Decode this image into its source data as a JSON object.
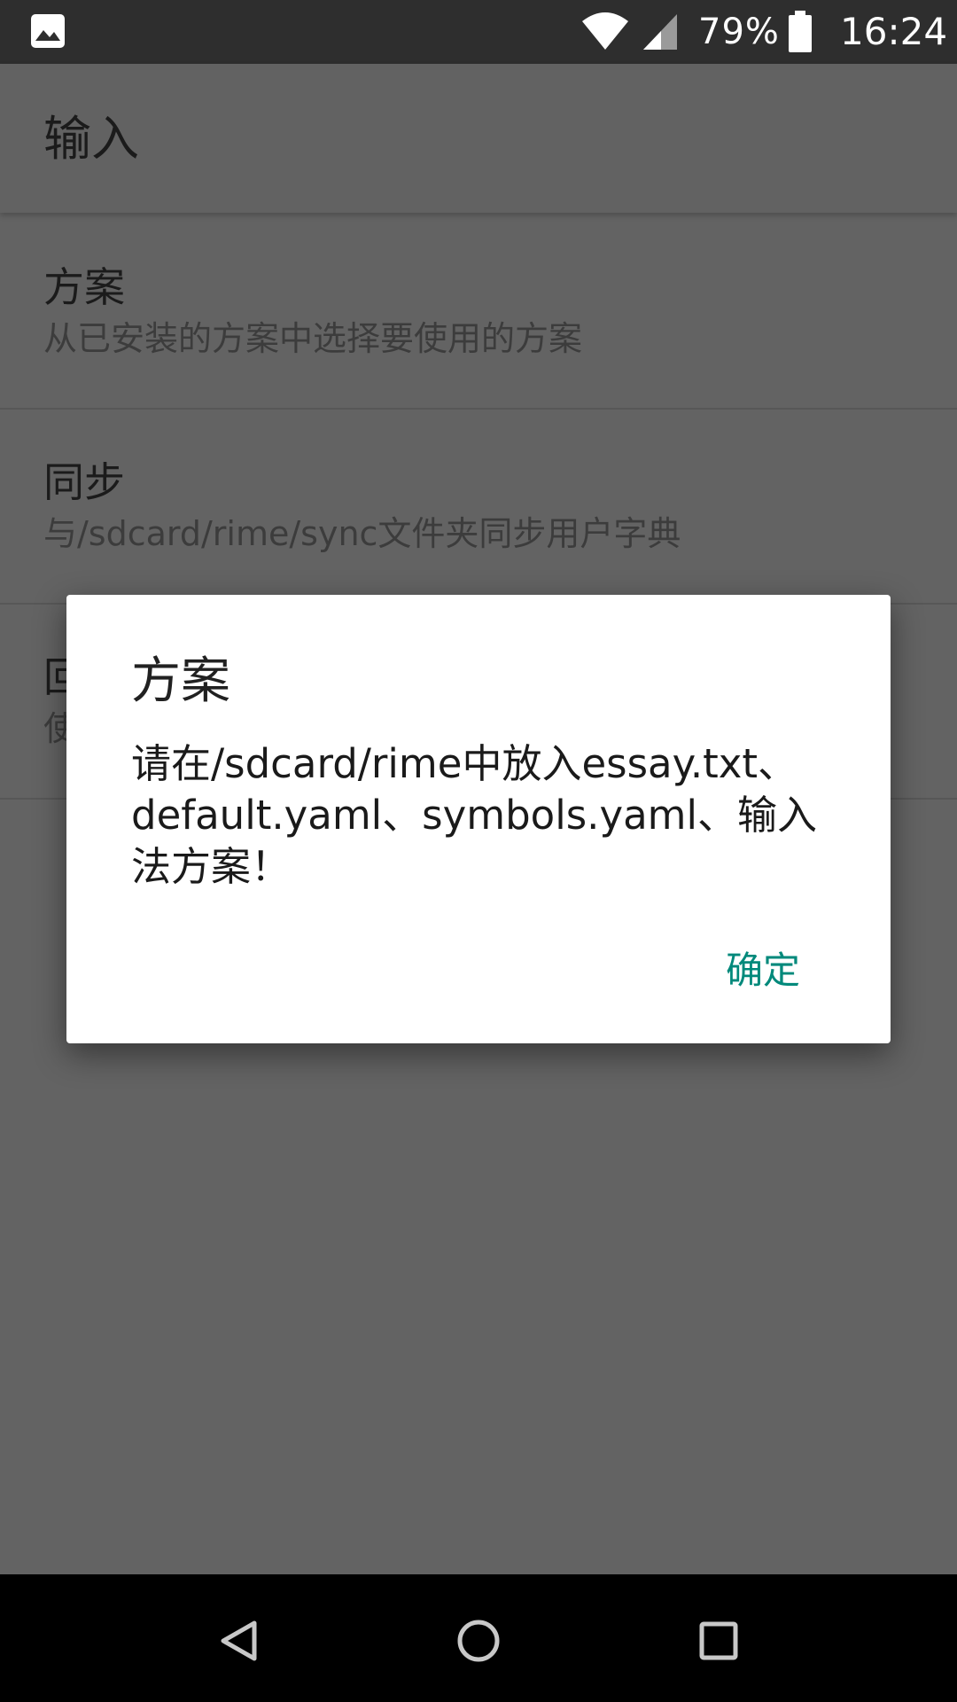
{
  "status_bar": {
    "icons": [
      "gallery-icon",
      "wifi-icon",
      "cell-signal-icon",
      "battery-icon"
    ],
    "battery_percent": "79%",
    "time": "16:24"
  },
  "app_bar": {
    "title": "输入"
  },
  "preferences": [
    {
      "title": "方案",
      "summary": "从已安装的方案中选择要使用的方案"
    },
    {
      "title": "同步",
      "summary": "与/sdcard/rime/sync文件夹同步用户字典"
    },
    {
      "title": "回",
      "summary": "使"
    }
  ],
  "dialog": {
    "title": "方案",
    "message": "请在/sdcard/rime中放入essay.txt、\ndefault.yaml、symbols.yaml、输入\n法方案！",
    "ok_label": "确定",
    "accent_color": "#00897b"
  },
  "nav_bar": {
    "buttons": [
      "back-icon",
      "home-icon",
      "recents-icon"
    ]
  },
  "colors": {
    "scrim_background": "#636363",
    "status_bar": "#2e2e2e",
    "nav_bar": "#000000"
  }
}
